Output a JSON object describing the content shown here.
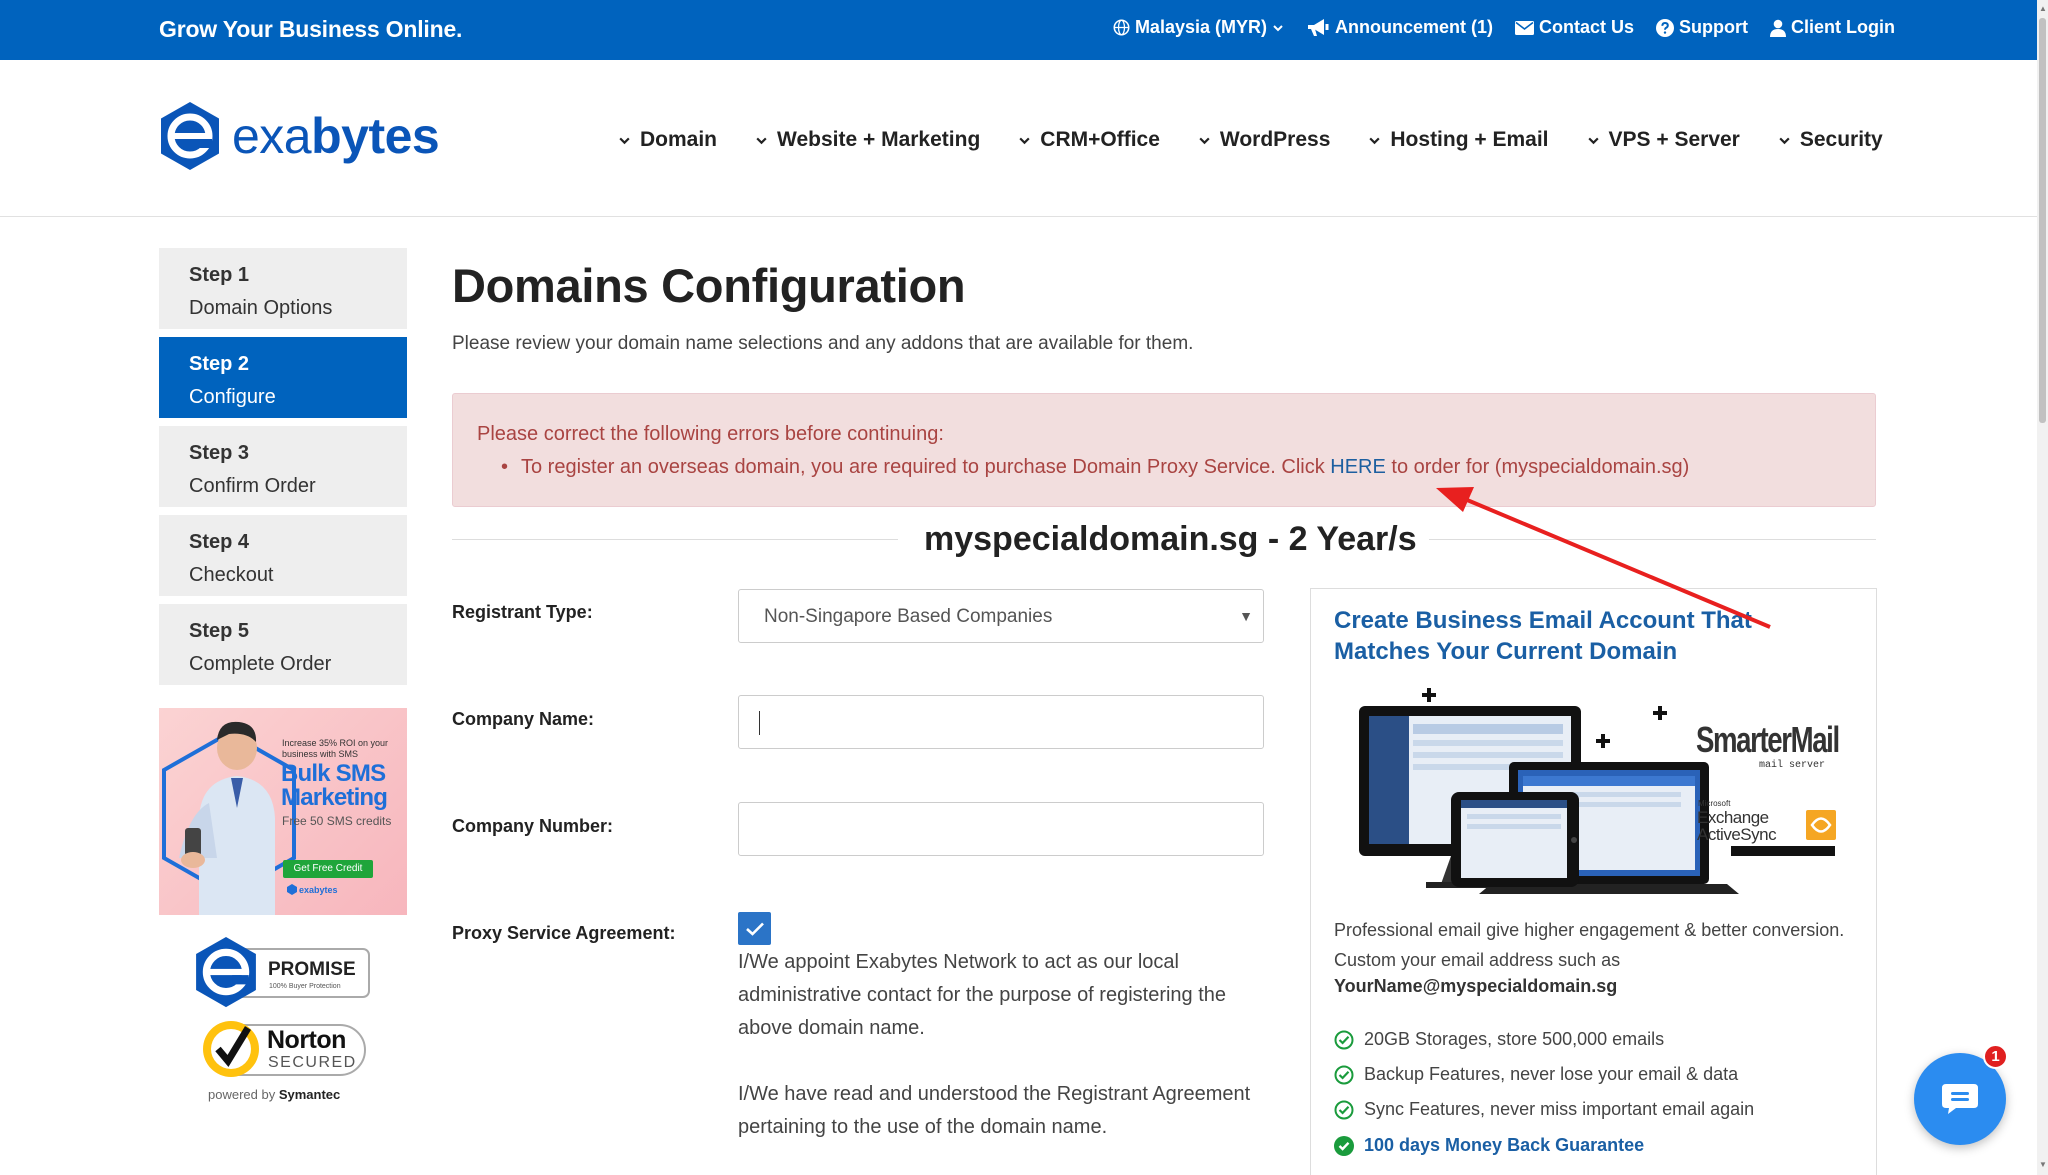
{
  "topbar": {
    "tagline": "Grow Your Business Online.",
    "links": {
      "region": "Malaysia (MYR)",
      "announcement": "Announcement (1)",
      "contact": "Contact Us",
      "support": "Support",
      "login": "Client Login"
    }
  },
  "header": {
    "logo_a": "exa",
    "logo_b": "bytes",
    "nav": [
      "Domain",
      "Website + Marketing",
      "CRM+Office",
      "WordPress",
      "Hosting + Email",
      "VPS + Server",
      "Security"
    ]
  },
  "steps": [
    {
      "num": "Step 1",
      "label": "Domain Options"
    },
    {
      "num": "Step 2",
      "label": "Configure"
    },
    {
      "num": "Step 3",
      "label": "Confirm Order"
    },
    {
      "num": "Step 4",
      "label": "Checkout"
    },
    {
      "num": "Step 5",
      "label": "Complete Order"
    }
  ],
  "banner": {
    "line1": "Increase 35% ROI on your",
    "line2": "business with SMS",
    "title1": "Bulk SMS",
    "title2": "Marketing",
    "sub": "Free 50 SMS credits",
    "cta": "Get Free Credit",
    "brand": "exabytes"
  },
  "badges": {
    "promise": "PROMISE",
    "promise_sub": "100% Buyer Protection",
    "norton": "Norton",
    "secured": "SECURED",
    "powered": "powered by",
    "symantec": "Symantec"
  },
  "main": {
    "title": "Domains Configuration",
    "subtitle": "Please review your domain name selections and any addons that are available for them.",
    "error_head": "Please correct the following errors before continuing:",
    "error_pre": "To register an overseas domain, you are required to purchase Domain Proxy Service. Click ",
    "error_link": "HERE",
    "error_post": " to order for (myspecialdomain.sg)",
    "domain_heading": "myspecialdomain.sg - 2 Year/s"
  },
  "form": {
    "registrant_label": "Registrant Type:",
    "registrant_value": "Non-Singapore Based Companies",
    "company_name_label": "Company Name:",
    "company_number_label": "Company Number:",
    "proxy_label": "Proxy Service Agreement:",
    "proxy_checked": true,
    "proxy_text1": "I/We appoint Exabytes Network to act as our local administrative contact for the purpose of registering the above domain name.",
    "proxy_text2": "I/We have read and understood the Registrant Agreement pertaining to the use of the domain name."
  },
  "promo": {
    "title": "Create Business Email Account That Matches Your Current Domain",
    "smartermail": "SmarterMail",
    "mailserver": "mail server",
    "microsoft": "Microsoft",
    "exchange": "Exchange",
    "activesync": "ActiveSync",
    "desc": "Professional email give higher engagement & better conversion. Custom your email address such as",
    "email": "YourName@myspecialdomain.sg",
    "features": [
      "20GB Storages, store 500,000 emails",
      "Backup Features, never lose your email & data",
      "Sync Features, never miss important email again",
      "100 days Money Back Guarantee"
    ]
  },
  "chat": {
    "badge": "1"
  },
  "colors": {
    "brand_blue": "#0063be",
    "error_bg": "#f2dede",
    "error_text": "#a94442",
    "check_green": "#1a9b3c",
    "annotation_red": "#e8201f"
  }
}
